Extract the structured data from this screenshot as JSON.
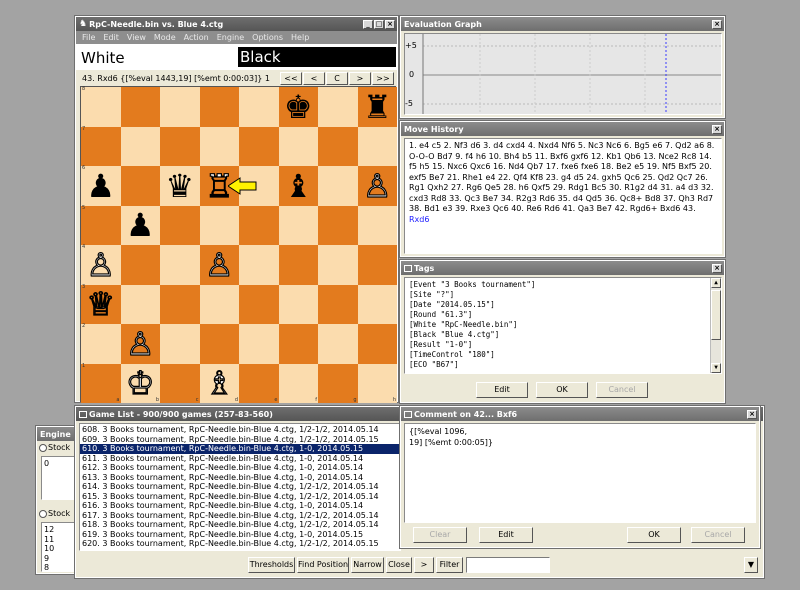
{
  "board_window": {
    "title": "RpC-Needle.bin vs. Blue 4.ctg",
    "menu": [
      "File",
      "Edit",
      "View",
      "Mode",
      "Action",
      "Engine",
      "Options",
      "Help"
    ],
    "white_label": "White",
    "black_label": "Black",
    "move_info": "43. Rxd6 {[%eval 1443,19] [%emt 0:00:03]} 1",
    "nav": [
      "<<",
      "<",
      "C",
      ">",
      ">>"
    ],
    "ranks": [
      "8",
      "7",
      "6",
      "5",
      "4",
      "3",
      "2",
      "1"
    ],
    "files": [
      "a",
      "b",
      "c",
      "d",
      "e",
      "f",
      "g",
      "h"
    ],
    "pieces": [
      [
        "",
        "",
        "",
        "",
        "",
        "♚b",
        "",
        "♜b"
      ],
      [
        "",
        "",
        "",
        "",
        "",
        "",
        "",
        ""
      ],
      [
        "♟b",
        "",
        "♛b",
        "♖w",
        "",
        "♝b",
        "",
        "♙w"
      ],
      [
        "",
        "♟b",
        "",
        "",
        "",
        "",
        "",
        ""
      ],
      [
        "♙w",
        "",
        "",
        "♙w",
        "",
        "",
        "",
        ""
      ],
      [
        "♕w",
        "",
        "",
        "",
        "",
        "",
        "",
        ""
      ],
      [
        "",
        "♙w",
        "",
        "",
        "",
        "",
        "",
        ""
      ],
      [
        "",
        "♔w",
        "",
        "♗w",
        "",
        "",
        "",
        ""
      ]
    ]
  },
  "eval_window": {
    "title": "Evaluation Graph",
    "ticks": [
      "+5",
      "0",
      "-5"
    ]
  },
  "move_history": {
    "title": "Move History",
    "text": "1. e4 c5 2. Nf3 d6 3. d4 cxd4 4. Nxd4 Nf6 5. Nc3 Nc6 6. Bg5 e6 7. Qd2 a6 8. O-O-O Bd7 9. f4 h6 10. Bh4 b5 11. Bxf6 gxf6 12. Kb1 Qb6 13. Nce2 Rc8 14. f5 h5 15. Nxc6 Qxc6 16. Nd4 Qb7 17. fxe6 fxe6 18. Be2 e5 19. Nf5 Bxf5 20. exf5 Be7 21. Rhe1 e4 22. Qf4 Kf8 23. g4 d5 24. gxh5 Qc6 25. Qd2 Qc7 26. Rg1 Qxh2 27. Rg6 Qe5 28. h6 Qxf5 29. Rdg1 Bc5 30. R1g2 d4 31. a4 d3 32. cxd3 Rd8 33. Qc3 Be7 34. R2g3 Rd6 35. d4 Qd5 36. Qc8+ Bd8 37. Qh3 Rd7 38. Bd1 e3 39. Rxe3 Qc6 40. Re6 Rd6 41. Qa3 Be7 42. Rgd6+ Bxd6 43.",
    "current_move": "Rxd6"
  },
  "tags": {
    "title": "Tags",
    "lines": [
      "[Event \"3 Books tournament\"]",
      "[Site \"?\"]",
      "[Date \"2014.05.15\"]",
      "[Round \"61.3\"]",
      "[White \"RpC-Needle.bin\"]",
      "[Black \"Blue 4.ctg\"]",
      "[Result \"1-0\"]",
      "[TimeControl \"180\"]",
      "[ECO \"B67\"]"
    ],
    "edit_label": "Edit",
    "ok_label": "OK",
    "cancel_label": "Cancel"
  },
  "game_list": {
    "title": "Game List - 900/900 games (257-83-560)",
    "rows": [
      "608. 3 Books tournament, RpC-Needle.bin-Blue 4.ctg, 1/2-1/2, 2014.05.14",
      "609. 3 Books tournament, RpC-Needle.bin-Blue 4.ctg, 1/2-1/2, 2014.05.15",
      "610. 3 Books tournament, RpC-Needle.bin-Blue 4.ctg, 1-0, 2014.05.15",
      "611. 3 Books tournament, RpC-Needle.bin-Blue 4.ctg, 1-0, 2014.05.14",
      "612. 3 Books tournament, RpC-Needle.bin-Blue 4.ctg, 1-0, 2014.05.14",
      "613. 3 Books tournament, RpC-Needle.bin-Blue 4.ctg, 1-0, 2014.05.14",
      "614. 3 Books tournament, RpC-Needle.bin-Blue 4.ctg, 1/2-1/2, 2014.05.14",
      "615. 3 Books tournament, RpC-Needle.bin-Blue 4.ctg, 1/2-1/2, 2014.05.14",
      "616. 3 Books tournament, RpC-Needle.bin-Blue 4.ctg, 1-0, 2014.05.14",
      "617. 3 Books tournament, RpC-Needle.bin-Blue 4.ctg, 1/2-1/2, 2014.05.14",
      "618. 3 Books tournament, RpC-Needle.bin-Blue 4.ctg, 1/2-1/2, 2014.05.14",
      "619. 3 Books tournament, RpC-Needle.bin-Blue 4.ctg, 1-0, 2014.05.15",
      "620. 3 Books tournament, RpC-Needle.bin-Blue 4.ctg, 1/2-1/2, 2014.05.15"
    ],
    "selected_index": 2,
    "buttons": [
      "Thresholds",
      "Find Position",
      "Narrow",
      "Close",
      ">",
      "Filter"
    ],
    "filter_value": ""
  },
  "comment": {
    "title": "Comment on 42... Bxf6",
    "text_line1": "{[%eval 1096,",
    "text_line2": "19] [%emt 0:00:05]}",
    "clear_label": "Clear",
    "edit_label": "Edit",
    "ok_label": "OK",
    "cancel_label": "Cancel"
  },
  "engine": {
    "title": "Engine ",
    "radio1": "Stock",
    "radio2": "Stock",
    "top_value": "0",
    "values": [
      "12",
      "11",
      "10",
      "9",
      "8"
    ]
  }
}
